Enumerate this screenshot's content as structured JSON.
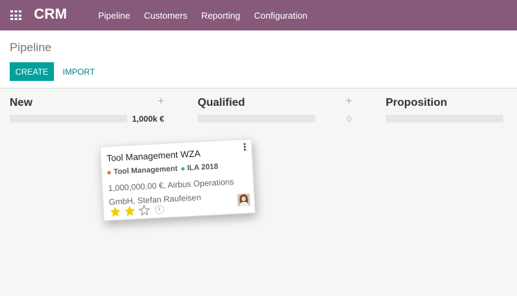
{
  "topbar": {
    "app_name": "CRM",
    "apps_icon": "apps-grid-icon",
    "menu": [
      "Pipeline",
      "Customers",
      "Reporting",
      "Configuration"
    ],
    "bg_color": "#875a7b"
  },
  "control_panel": {
    "breadcrumb": "Pipeline",
    "create_label": "CREATE",
    "import_label": "IMPORT",
    "accent_color": "#00a09d"
  },
  "columns": [
    {
      "title": "New",
      "add_icon": "+",
      "total": "1,000k €",
      "has_add": true
    },
    {
      "title": "Qualified",
      "add_icon": "+",
      "total": "0",
      "has_add": true
    },
    {
      "title": "Proposition",
      "total": ""
    }
  ],
  "card": {
    "title": "Tool Management WZA",
    "tags": [
      {
        "label": "Tool Management",
        "color": "#e06b50"
      },
      {
        "label": "ILA 2018",
        "color": "#2ebd84"
      }
    ],
    "description": "1,000,000.00 €, Airbus Operations GmbH, Stefan Raufeisen",
    "priority": {
      "filled": 2,
      "total": 3,
      "star_color": "#f3cc00"
    },
    "icons": [
      "kebab-menu-icon",
      "star-icon",
      "clock-icon",
      "avatar"
    ]
  }
}
